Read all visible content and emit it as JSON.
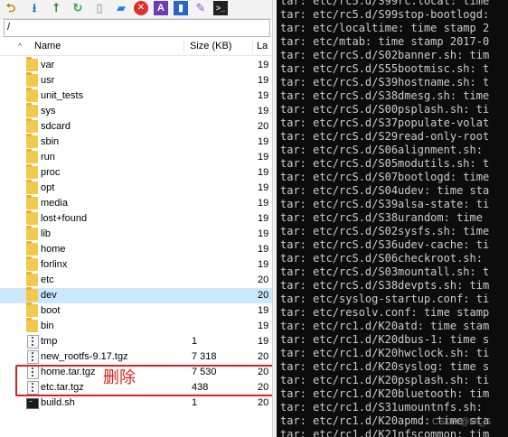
{
  "toolbar": {
    "icons": [
      "back-icon",
      "download-icon",
      "up-arrow-icon",
      "refresh-icon",
      "new-file-icon",
      "new-folder-icon",
      "delete-icon",
      "rename-icon",
      "properties-icon",
      "edit-icon",
      "terminal-icon"
    ]
  },
  "path": {
    "value": "/"
  },
  "columns": {
    "name": "Name",
    "size": "Size (KB)",
    "date": "La"
  },
  "files": [
    {
      "name": "var",
      "size": "",
      "date": "19",
      "type": "folder"
    },
    {
      "name": "usr",
      "size": "",
      "date": "19",
      "type": "folder"
    },
    {
      "name": "unit_tests",
      "size": "",
      "date": "19",
      "type": "folder"
    },
    {
      "name": "sys",
      "size": "",
      "date": "19",
      "type": "folder"
    },
    {
      "name": "sdcard",
      "size": "",
      "date": "20",
      "type": "folder"
    },
    {
      "name": "sbin",
      "size": "",
      "date": "19",
      "type": "folder"
    },
    {
      "name": "run",
      "size": "",
      "date": "19",
      "type": "folder"
    },
    {
      "name": "proc",
      "size": "",
      "date": "19",
      "type": "folder"
    },
    {
      "name": "opt",
      "size": "",
      "date": "19",
      "type": "folder"
    },
    {
      "name": "media",
      "size": "",
      "date": "19",
      "type": "folder"
    },
    {
      "name": "lost+found",
      "size": "",
      "date": "19",
      "type": "folder"
    },
    {
      "name": "lib",
      "size": "",
      "date": "19",
      "type": "folder"
    },
    {
      "name": "home",
      "size": "",
      "date": "19",
      "type": "folder"
    },
    {
      "name": "forlinx",
      "size": "",
      "date": "19",
      "type": "folder"
    },
    {
      "name": "etc",
      "size": "",
      "date": "20",
      "type": "folder"
    },
    {
      "name": "dev",
      "size": "",
      "date": "20",
      "type": "folder",
      "selected": true
    },
    {
      "name": "boot",
      "size": "",
      "date": "19",
      "type": "folder"
    },
    {
      "name": "bin",
      "size": "",
      "date": "19",
      "type": "folder"
    },
    {
      "name": "tmp",
      "size": "1",
      "date": "19",
      "type": "zip"
    },
    {
      "name": "new_rootfs-9.17.tgz",
      "size": "7 318",
      "date": "20",
      "type": "zip"
    },
    {
      "name": "home.tar.tgz",
      "size": "7 530",
      "date": "20",
      "type": "zip"
    },
    {
      "name": "etc.tar.tgz",
      "size": "438",
      "date": "20",
      "type": "zip"
    },
    {
      "name": "build.sh",
      "size": "1",
      "date": "20",
      "type": "script"
    }
  ],
  "annotation": {
    "text": "删除",
    "color": "#e02020"
  },
  "terminal": {
    "lines": [
      "tar: etc/rc5.d/S99rc.local: time",
      "tar: etc/rc5.d/S99stop-bootlogd:",
      "tar: etc/localtime: time stamp 2",
      "tar: etc/mtab: time stamp 2017-0",
      "tar: etc/rcS.d/S02banner.sh: tim",
      "tar: etc/rcS.d/S55bootmisc.sh: t",
      "tar: etc/rcS.d/S39hostname.sh: t",
      "tar: etc/rcS.d/S38dmesg.sh: time",
      "tar: etc/rcS.d/S00psplash.sh: ti",
      "tar: etc/rcS.d/S37populate-volat",
      "tar: etc/rcS.d/S29read-only-root",
      "tar: etc/rcS.d/S06alignment.sh: ",
      "tar: etc/rcS.d/S05modutils.sh: t",
      "tar: etc/rcS.d/S07bootlogd: time",
      "tar: etc/rcS.d/S04udev: time sta",
      "tar: etc/rcS.d/S39alsa-state: ti",
      "tar: etc/rcS.d/S38urandom: time ",
      "tar: etc/rcS.d/S02sysfs.sh: time",
      "tar: etc/rcS.d/S36udev-cache: ti",
      "tar: etc/rcS.d/S06checkroot.sh: ",
      "tar: etc/rcS.d/S03mountall.sh: t",
      "tar: etc/rcS.d/S38devpts.sh: tim",
      "tar: etc/syslog-startup.conf: ti",
      "tar: etc/resolv.conf: time stamp",
      "tar: etc/rc1.d/K20atd: time stam",
      "tar: etc/rc1.d/K20dbus-1: time s",
      "tar: etc/rc1.d/K20hwclock.sh: ti",
      "tar: etc/rc1.d/K20syslog: time s",
      "tar: etc/rc1.d/K20psplash.sh: ti",
      "tar: etc/rc1.d/K20bluetooth: tim",
      "tar: etc/rc1.d/S31umountnfs.sh: ",
      "tar: etc/rc1.d/K20apmd: time sta",
      "tar: etc/rc1.d/K21nfscommon: tim"
    ]
  },
  "watermark": "CSDN @Mr_S"
}
